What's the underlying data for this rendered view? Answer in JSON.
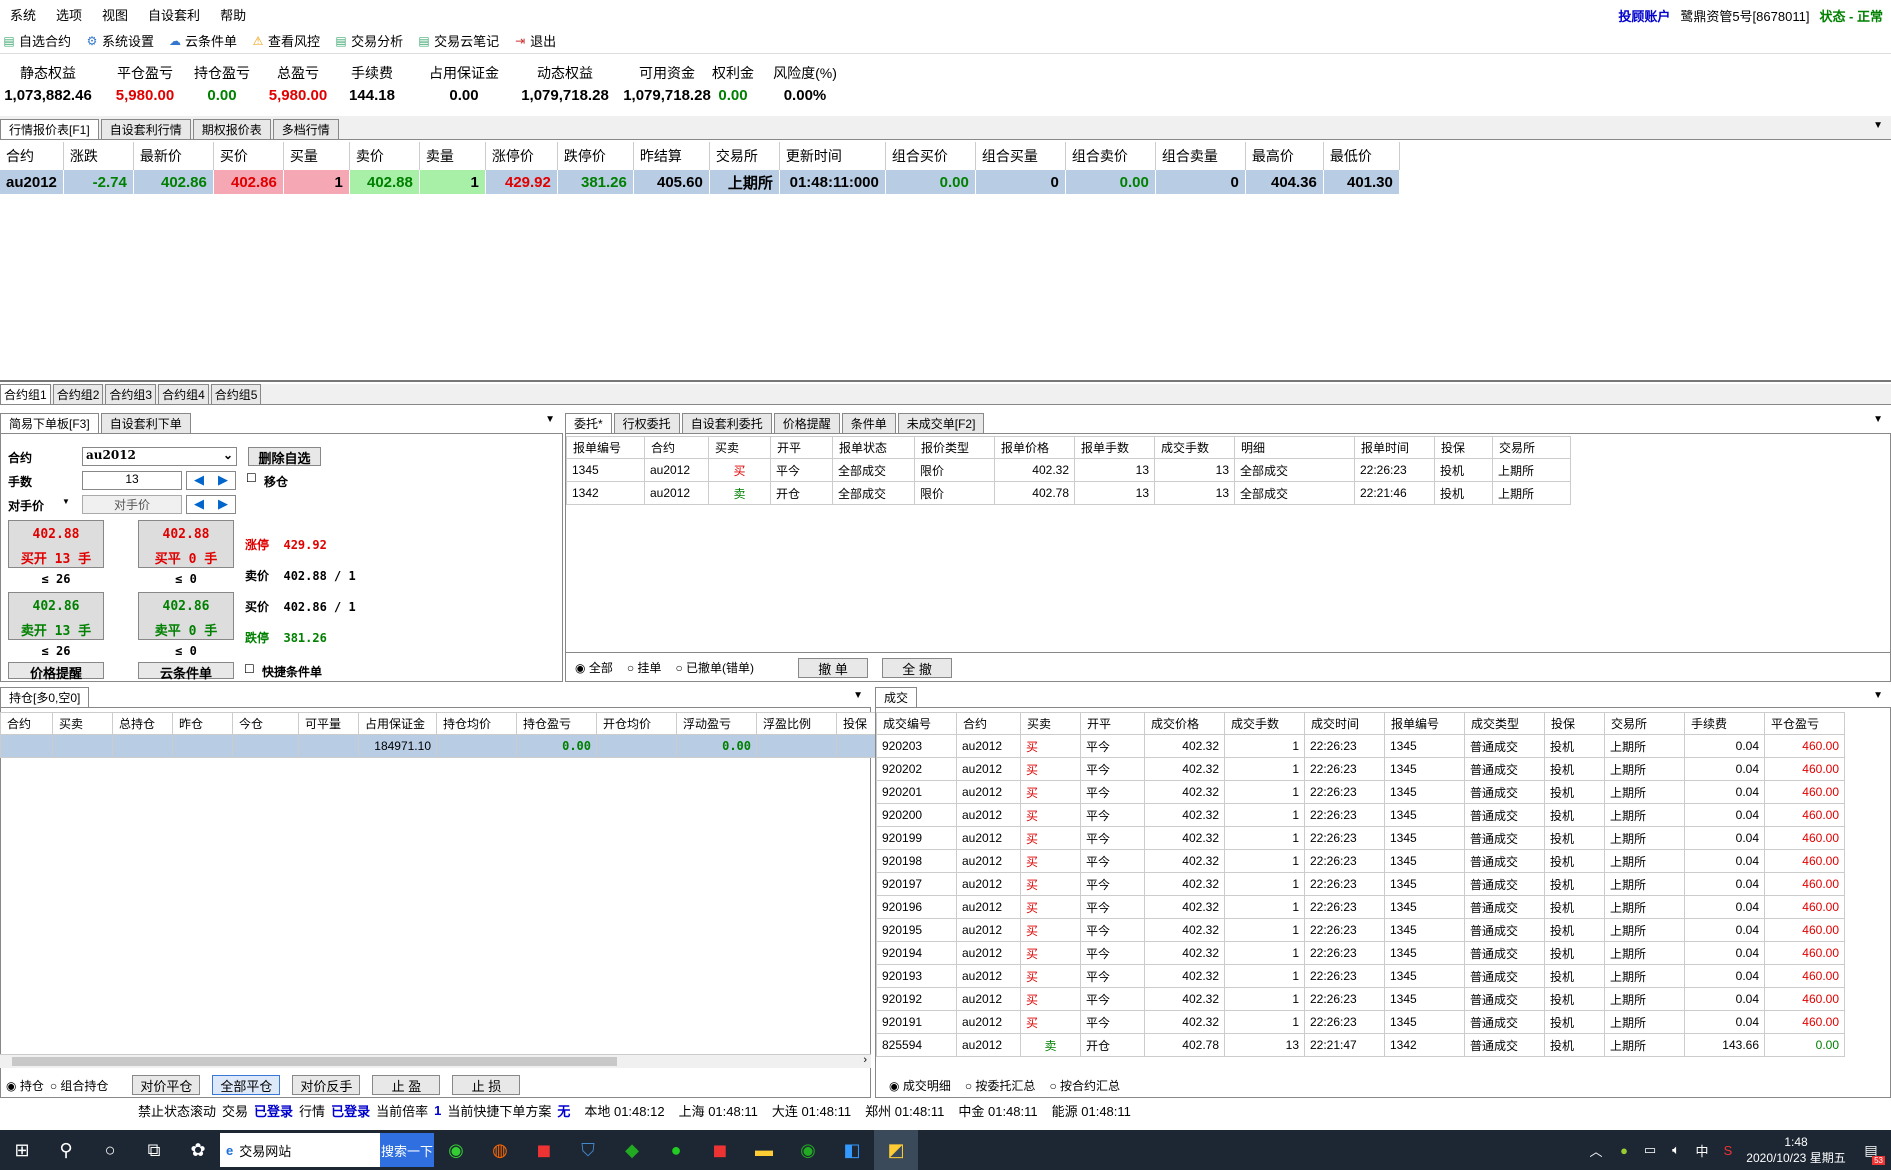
{
  "menu": [
    "系统",
    "选项",
    "视图",
    "自设套利",
    "帮助"
  ],
  "account": {
    "type": "投顾账户",
    "name": "鹭鼎资管5号[8678011]",
    "status": "状态 - 正常"
  },
  "toolbar": [
    {
      "label": "自选合约",
      "icon": "document-icon"
    },
    {
      "label": "系统设置",
      "icon": "gear-icon"
    },
    {
      "label": "云条件单",
      "icon": "cloud-icon"
    },
    {
      "label": "查看风控",
      "icon": "warning-icon"
    },
    {
      "label": "交易分析",
      "icon": "document-icon"
    },
    {
      "label": "交易云笔记",
      "icon": "document-icon"
    },
    {
      "label": "退出",
      "icon": "exit-icon"
    }
  ],
  "summary": [
    {
      "label": "静态权益",
      "value": "1,073,882.46",
      "color": "#000000"
    },
    {
      "label": "平仓盈亏",
      "value": "5,980.00",
      "color": "#e00000"
    },
    {
      "label": "持仓盈亏",
      "value": "0.00",
      "color": "#008000"
    },
    {
      "label": "总盈亏",
      "value": "5,980.00",
      "color": "#e00000"
    },
    {
      "label": "手续费",
      "value": "144.18",
      "color": "#000000"
    },
    {
      "label": "占用保证金",
      "value": "0.00",
      "color": "#000000"
    },
    {
      "label": "动态权益",
      "value": "1,079,718.28",
      "color": "#000000"
    },
    {
      "label": "可用资金",
      "value": "1,079,718.28",
      "color": "#000000"
    },
    {
      "label": "权利金",
      "value": "0.00",
      "color": "#008000"
    },
    {
      "label": "风险度(%)",
      "value": "0.00%",
      "color": "#000000"
    }
  ],
  "quote_tabs": [
    "行情报价表[F1]",
    "自设套利行情",
    "期权报价表",
    "多档行情"
  ],
  "quote": {
    "headers": [
      "合约",
      "涨跌",
      "最新价",
      "买价",
      "买量",
      "卖价",
      "卖量",
      "涨停价",
      "跌停价",
      "昨结算",
      "交易所",
      "更新时间",
      "组合买价",
      "组合买量",
      "组合卖价",
      "组合卖量",
      "最高价",
      "最低价"
    ],
    "row": [
      "au2012",
      "-2.74",
      "402.86",
      "402.86",
      "1",
      "402.88",
      "1",
      "429.92",
      "381.26",
      "405.60",
      "上期所",
      "01:48:11:000",
      "0.00",
      "0",
      "0.00",
      "0",
      "404.36",
      "401.30"
    ]
  },
  "groups": [
    "合约组1",
    "合约组2",
    "合约组3",
    "合约组4",
    "合约组5"
  ],
  "order_tabs": [
    "简易下单板[F3]",
    "自设套利下单"
  ],
  "order": {
    "contract_label": "合约",
    "contract": "au2012",
    "delete_btn": "删除自选",
    "qty_label": "手数",
    "qty": "13",
    "move_label": "移仓",
    "price_mode": "对手价",
    "price_placeholder": "对手价",
    "buy_open_price": "402.88",
    "buy_open": "买开 13 手",
    "buy_open_cnt": "≤ 26",
    "buy_close_price": "402.88",
    "buy_close": "买平 0 手",
    "buy_close_cnt": "≤ 0",
    "sell_open_price": "402.86",
    "sell_open": "卖开 13 手",
    "sell_open_cnt": "≤ 26",
    "sell_close_price": "402.86",
    "sell_close": "卖平 0 手",
    "sell_close_cnt": "≤ 0",
    "limit_up_label": "涨停",
    "limit_up": "429.92",
    "ask_label": "卖价",
    "ask": "402.88 / 1",
    "bid_label": "买价",
    "bid": "402.86 / 1",
    "limit_down_label": "跌停",
    "limit_down": "381.26",
    "price_alert": "价格提醒",
    "cloud_cond": "云条件单",
    "quick_cond": "快捷条件单"
  },
  "entrust_tabs": [
    "委托*",
    "行权委托",
    "自设套利委托",
    "价格提醒",
    "条件单",
    "未成交单[F2]"
  ],
  "entrust": {
    "headers": [
      "报单编号",
      "合约",
      "买卖",
      "开平",
      "报单状态",
      "报价类型",
      "报单价格",
      "报单手数",
      "成交手数",
      "明细",
      "报单时间",
      "投保",
      "交易所"
    ],
    "rows": [
      [
        "1345",
        "au2012",
        "买",
        "平今",
        "全部成交",
        "限价",
        "402.32",
        "13",
        "13",
        "全部成交",
        "22:26:23",
        "投机",
        "上期所"
      ],
      [
        "1342",
        "au2012",
        "卖",
        "开仓",
        "全部成交",
        "限价",
        "402.78",
        "13",
        "13",
        "全部成交",
        "22:21:46",
        "投机",
        "上期所"
      ]
    ],
    "radios": [
      "全部",
      "挂单",
      "已撤单(错单)"
    ],
    "cancel": "撤 单",
    "cancel_all": "全 撤"
  },
  "position_tab": "持仓[多0,空0]",
  "position": {
    "headers": [
      "合约",
      "买卖",
      "总持仓",
      "昨仓",
      "今仓",
      "可平量",
      "占用保证金",
      "持仓均价",
      "持仓盈亏",
      "开仓均价",
      "浮动盈亏",
      "浮盈比例",
      "投保"
    ],
    "row": [
      "",
      "",
      "",
      "",
      "",
      "",
      "184971.10",
      "",
      "0.00",
      "",
      "0.00",
      "",
      ""
    ],
    "radios": [
      "持仓",
      "组合持仓"
    ],
    "buttons": [
      "对价平仓",
      "全部平仓",
      "对价反手",
      "止 盈",
      "止 损"
    ]
  },
  "trade_tab": "成交",
  "trades": {
    "headers": [
      "成交编号",
      "合约",
      "买卖",
      "开平",
      "成交价格",
      "成交手数",
      "成交时间",
      "报单编号",
      "成交类型",
      "投保",
      "交易所",
      "手续费",
      "平仓盈亏"
    ],
    "rows": [
      [
        "920203",
        "au2012",
        "买",
        "平今",
        "402.32",
        "1",
        "22:26:23",
        "1345",
        "普通成交",
        "投机",
        "上期所",
        "0.04",
        "460.00"
      ],
      [
        "920202",
        "au2012",
        "买",
        "平今",
        "402.32",
        "1",
        "22:26:23",
        "1345",
        "普通成交",
        "投机",
        "上期所",
        "0.04",
        "460.00"
      ],
      [
        "920201",
        "au2012",
        "买",
        "平今",
        "402.32",
        "1",
        "22:26:23",
        "1345",
        "普通成交",
        "投机",
        "上期所",
        "0.04",
        "460.00"
      ],
      [
        "920200",
        "au2012",
        "买",
        "平今",
        "402.32",
        "1",
        "22:26:23",
        "1345",
        "普通成交",
        "投机",
        "上期所",
        "0.04",
        "460.00"
      ],
      [
        "920199",
        "au2012",
        "买",
        "平今",
        "402.32",
        "1",
        "22:26:23",
        "1345",
        "普通成交",
        "投机",
        "上期所",
        "0.04",
        "460.00"
      ],
      [
        "920198",
        "au2012",
        "买",
        "平今",
        "402.32",
        "1",
        "22:26:23",
        "1345",
        "普通成交",
        "投机",
        "上期所",
        "0.04",
        "460.00"
      ],
      [
        "920197",
        "au2012",
        "买",
        "平今",
        "402.32",
        "1",
        "22:26:23",
        "1345",
        "普通成交",
        "投机",
        "上期所",
        "0.04",
        "460.00"
      ],
      [
        "920196",
        "au2012",
        "买",
        "平今",
        "402.32",
        "1",
        "22:26:23",
        "1345",
        "普通成交",
        "投机",
        "上期所",
        "0.04",
        "460.00"
      ],
      [
        "920195",
        "au2012",
        "买",
        "平今",
        "402.32",
        "1",
        "22:26:23",
        "1345",
        "普通成交",
        "投机",
        "上期所",
        "0.04",
        "460.00"
      ],
      [
        "920194",
        "au2012",
        "买",
        "平今",
        "402.32",
        "1",
        "22:26:23",
        "1345",
        "普通成交",
        "投机",
        "上期所",
        "0.04",
        "460.00"
      ],
      [
        "920193",
        "au2012",
        "买",
        "平今",
        "402.32",
        "1",
        "22:26:23",
        "1345",
        "普通成交",
        "投机",
        "上期所",
        "0.04",
        "460.00"
      ],
      [
        "920192",
        "au2012",
        "买",
        "平今",
        "402.32",
        "1",
        "22:26:23",
        "1345",
        "普通成交",
        "投机",
        "上期所",
        "0.04",
        "460.00"
      ],
      [
        "920191",
        "au2012",
        "买",
        "平今",
        "402.32",
        "1",
        "22:26:23",
        "1345",
        "普通成交",
        "投机",
        "上期所",
        "0.04",
        "460.00"
      ],
      [
        "825594",
        "au2012",
        "卖",
        "开仓",
        "402.78",
        "13",
        "22:21:47",
        "1342",
        "普通成交",
        "投机",
        "上期所",
        "143.66",
        "0.00"
      ]
    ],
    "radios": [
      "成交明细",
      "按委托汇总",
      "按合约汇总"
    ]
  },
  "status": [
    {
      "t": "禁止状态滚动",
      "c": "#000"
    },
    {
      "t": "交易",
      "c": "#000"
    },
    {
      "t": "已登录",
      "c": "#0000cc"
    },
    {
      "t": "行情",
      "c": "#000"
    },
    {
      "t": "已登录",
      "c": "#0000cc"
    },
    {
      "t": "当前倍率",
      "c": "#000"
    },
    {
      "t": "1",
      "c": "#0000cc"
    },
    {
      "t": "当前快捷下单方案",
      "c": "#000"
    },
    {
      "t": "无",
      "c": "#0000cc"
    },
    {
      "t": "本地 01:48:12",
      "c": "#000"
    },
    {
      "t": "上海 01:48:11",
      "c": "#000"
    },
    {
      "t": "大连 01:48:11",
      "c": "#000"
    },
    {
      "t": "郑州 01:48:11",
      "c": "#000"
    },
    {
      "t": "中金 01:48:11",
      "c": "#000"
    },
    {
      "t": "能源 01:48:11",
      "c": "#000"
    }
  ],
  "taskbar": {
    "search_text": "交易网站",
    "search_btn": "搜索一下",
    "time": "1:48",
    "date": "2020/10/23 星期五",
    "ime": "中",
    "badge": "53"
  }
}
